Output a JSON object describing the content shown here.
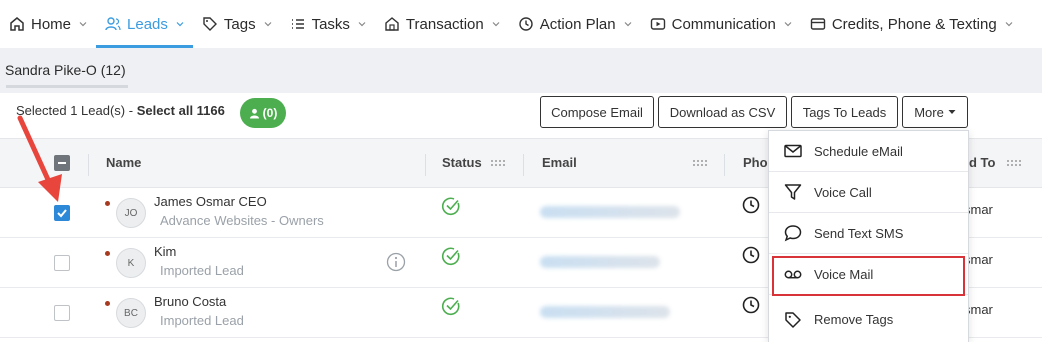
{
  "nav": {
    "items": [
      {
        "label": "Home",
        "icon": "home-icon"
      },
      {
        "label": "Leads",
        "icon": "users-icon",
        "active": true
      },
      {
        "label": "Tags",
        "icon": "tag-icon"
      },
      {
        "label": "Tasks",
        "icon": "list-icon"
      },
      {
        "label": "Transaction",
        "icon": "bank-icon"
      },
      {
        "label": "Action Plan",
        "icon": "clock-icon"
      },
      {
        "label": "Communication",
        "icon": "play-icon"
      },
      {
        "label": "Credits, Phone & Texting",
        "icon": "card-icon"
      }
    ]
  },
  "subtab": {
    "label": "Sandra Pike-O (12)"
  },
  "selection": {
    "prefix": "Selected 1 Lead(s) - ",
    "select_all": "Select all 1166",
    "badge": "(0)"
  },
  "toolbar": {
    "compose_email": "Compose Email",
    "download_csv": "Download as CSV",
    "tags_to_leads": "Tags To Leads",
    "more": "More"
  },
  "table": {
    "headers": {
      "name": "Name",
      "status": "Status",
      "email": "Email",
      "phone": "Phon",
      "assigned": "d To"
    },
    "rows": [
      {
        "initials": "JO",
        "name": "James Osmar CEO",
        "sub": "Advance Websites - Owners",
        "assigned": "smar",
        "checked": true
      },
      {
        "initials": "K",
        "name": "Kim",
        "sub": "Imported Lead",
        "assigned": "smar",
        "checked": false
      },
      {
        "initials": "BC",
        "name": "Bruno Costa",
        "sub": "Imported Lead",
        "assigned": "smar",
        "checked": false
      }
    ]
  },
  "more_menu": {
    "items": [
      {
        "label": "Schedule eMail",
        "icon": "envelope-icon"
      },
      {
        "label": "Voice Call",
        "icon": "funnel-icon"
      },
      {
        "label": "Send Text SMS",
        "icon": "chat-bubble-icon"
      },
      {
        "label": "Voice Mail",
        "icon": "voicemail-icon"
      },
      {
        "label": "Remove Tags",
        "icon": "tag-icon"
      }
    ]
  },
  "colors": {
    "accent": "#3b9ce0",
    "badge": "#4cae4f",
    "highlight": "#d9333a",
    "arrow": "#e8453c",
    "status_check": "#4cae4f"
  }
}
